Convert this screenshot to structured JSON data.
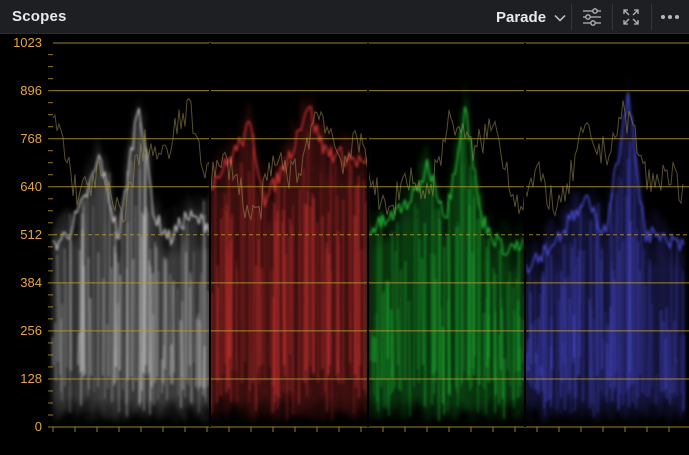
{
  "header": {
    "title": "Scopes",
    "mode": "Parade",
    "icons": [
      "chevron-down-icon",
      "sliders-icon",
      "expand-icon",
      "more-icon"
    ]
  },
  "scope": {
    "type": "RGB Parade waveform",
    "y_ticks": [
      "1023",
      "896",
      "768",
      "640",
      "512",
      "384",
      "256",
      "128",
      "0"
    ],
    "y_range": [
      0,
      1023
    ],
    "channels": [
      "luma",
      "red",
      "green",
      "blue"
    ],
    "colors": {
      "graticule": "#b39a2e",
      "label": "#e5a63d",
      "luma": "#e8e8e8",
      "red": "#ff4040",
      "green": "#28e040",
      "blue": "#5a5aff",
      "overlay": "#9c8f52"
    }
  }
}
